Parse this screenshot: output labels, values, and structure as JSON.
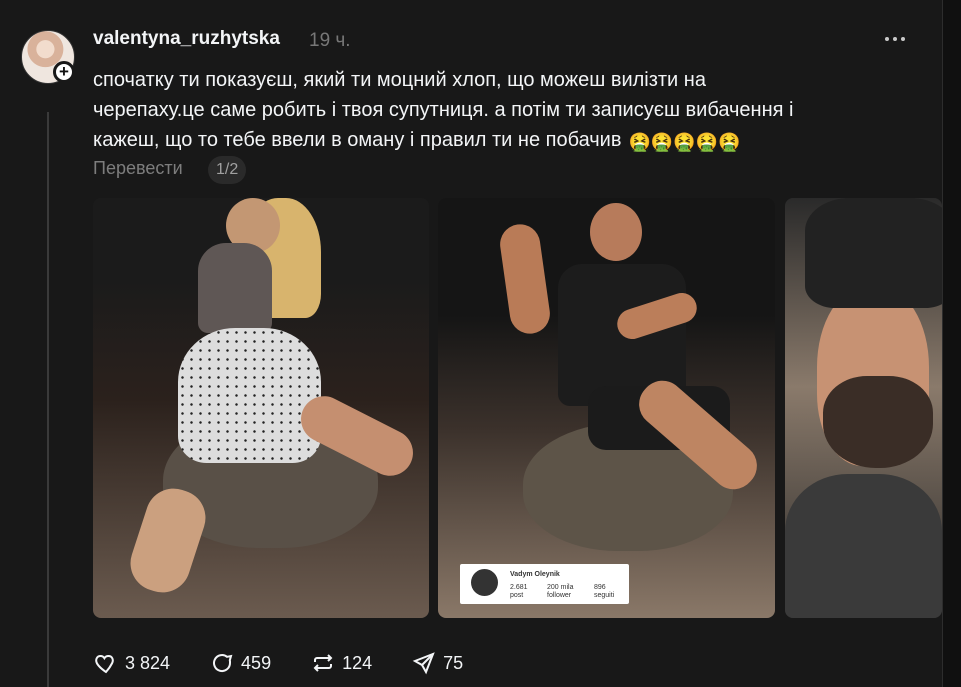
{
  "post": {
    "username": "valentyna_ruzhytska",
    "time": "19 ч.",
    "text_lines": [
      "спочатку ти показуєш, який ти моцний хлоп, що можеш вилізти на",
      "черепаху.це саме робить і твоя супутниця. а потім ти записуєш вибачення і",
      "кажеш, що то тебе ввели в оману і правил ти не побачив"
    ],
    "emoji": "🤮🤮🤮🤮🤮",
    "translate": "Перевести",
    "page_indicator": "1/2"
  },
  "images": [
    {
      "icon": "woman-on-turtle-photo"
    },
    {
      "icon": "man-on-turtle-photo"
    },
    {
      "icon": "man-selfie-video"
    }
  ],
  "overlay_card": {
    "name": "Vadym Oleynik",
    "post_count": "2.681",
    "post_label": "post",
    "follower_count": "200 mila",
    "follower_label": "follower",
    "following_count": "896",
    "following_label": "seguiti"
  },
  "actions": [
    {
      "name": "like",
      "icon": "heart-icon",
      "count": "3 824"
    },
    {
      "name": "comment",
      "icon": "comment-icon",
      "count": "459"
    },
    {
      "name": "repost",
      "icon": "repost-icon",
      "count": "124"
    },
    {
      "name": "share",
      "icon": "share-icon",
      "count": "75"
    }
  ],
  "colors": {
    "background": "#101010",
    "panel": "#181818",
    "text": "#f3f5f7",
    "muted": "#777777"
  }
}
